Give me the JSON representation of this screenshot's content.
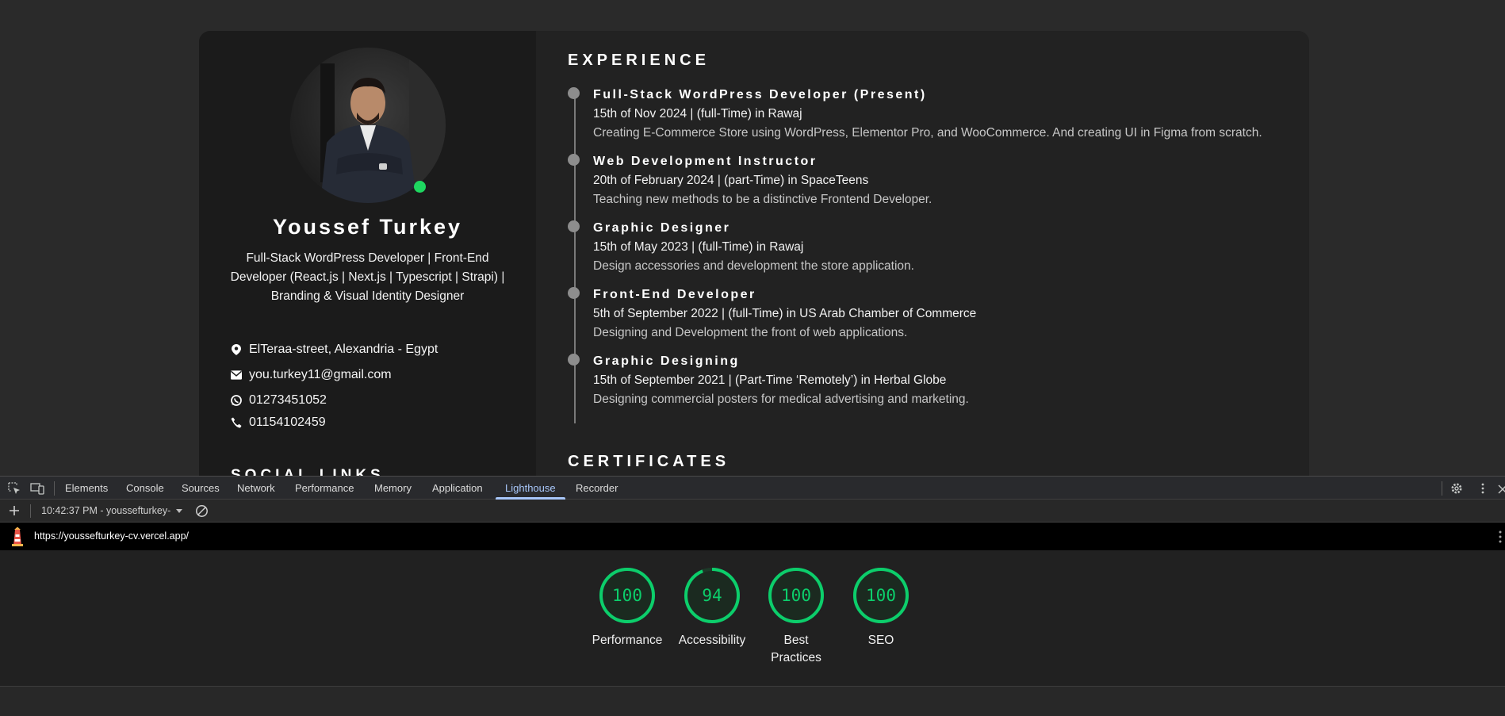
{
  "profile": {
    "name": "Youssef Turkey",
    "tagline": "Full-Stack WordPress Developer | Front-End Developer (React.js | Next.js | Typescript | Strapi) | Branding & Visual Identity Designer",
    "contacts": {
      "address": "ElTeraa-street, Alexandria - Egypt",
      "email": "you.turkey11@gmail.com",
      "whatsapp": "01273451052",
      "phone": "01154102459"
    },
    "social_title": "SOCIAL LINKS"
  },
  "experience": {
    "title": "EXPERIENCE",
    "items": [
      {
        "role": "Full-Stack WordPress Developer (Present)",
        "meta": "15th of Nov 2024 | (full-Time) in Rawaj",
        "desc": "Creating E-Commerce Store using WordPress, Elementor Pro, and WooCommerce. And creating UI in Figma from scratch."
      },
      {
        "role": "Web Development Instructor",
        "meta": "20th of February 2024 | (part-Time) in SpaceTeens",
        "desc": "Teaching new methods to be a distinctive Frontend Developer."
      },
      {
        "role": "Graphic Designer",
        "meta": "15th of May 2023 | (full-Time) in Rawaj",
        "desc": "Design accessories and development the store application."
      },
      {
        "role": "Front-End Developer",
        "meta": "5th of September 2022 | (full-Time) in US Arab Chamber of Commerce",
        "desc": "Designing and Development the front of web applications."
      },
      {
        "role": "Graphic Designing",
        "meta": "15th of September 2021 | (Part-Time ‘Remotely’) in Herbal Globe",
        "desc": "Designing commercial posters for medical advertising and marketing."
      }
    ]
  },
  "certificates": {
    "title": "CERTIFICATES"
  },
  "devtools": {
    "tabs": [
      "Elements",
      "Console",
      "Sources",
      "Network",
      "Performance",
      "Memory",
      "Application",
      "Lighthouse",
      "Recorder"
    ],
    "active_tab": "Lighthouse",
    "report_selector": "10:42:37 PM - youssefturkey-",
    "url": "https://youssefturkey-cv.vercel.app/",
    "scores": [
      {
        "value": "100",
        "label": "Performance",
        "percent": 100
      },
      {
        "value": "94",
        "label": "Accessibility",
        "percent": 94
      },
      {
        "value": "100",
        "label": "Best Practices",
        "percent": 100
      },
      {
        "value": "100",
        "label": "SEO",
        "percent": 100
      }
    ],
    "colors": {
      "pass": "#0cce6b",
      "accent": "#a8c7fa"
    }
  }
}
